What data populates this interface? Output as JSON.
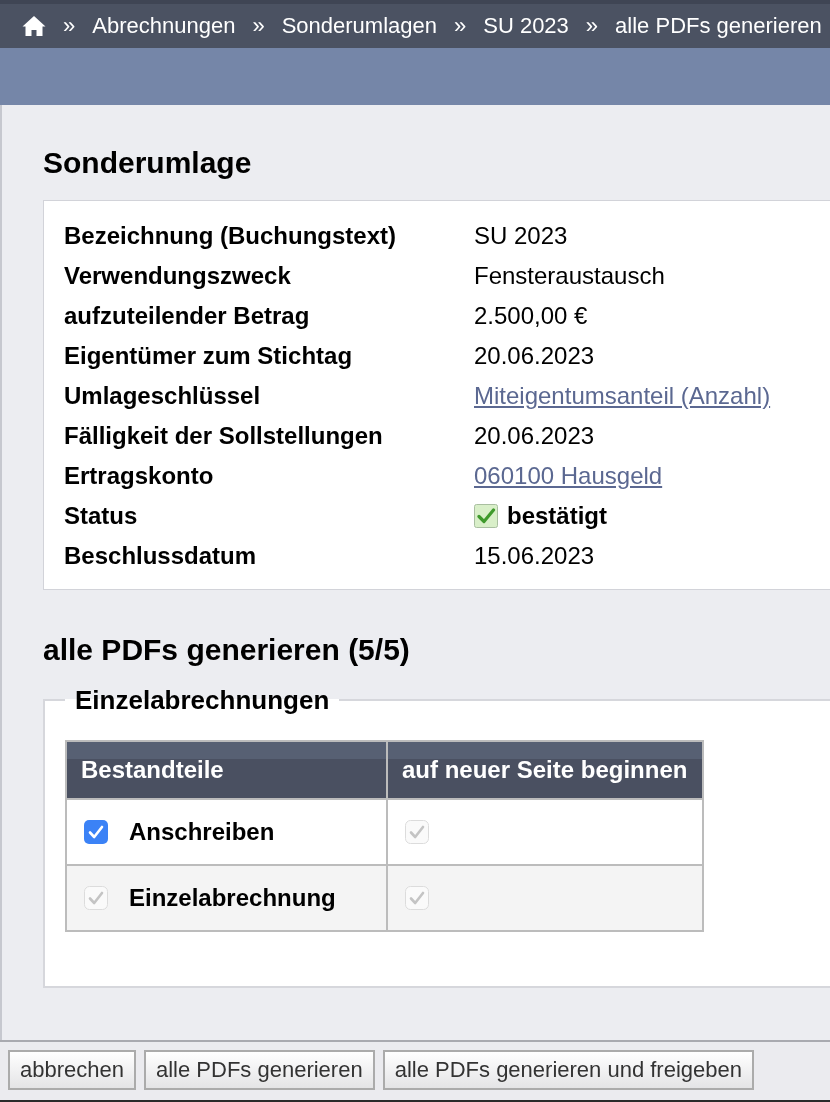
{
  "breadcrumb": {
    "items": [
      {
        "separator": "»",
        "label": "Abrechnungen"
      },
      {
        "separator": "»",
        "label": "Sonderumlagen"
      },
      {
        "separator": "»",
        "label": "SU 2023"
      },
      {
        "separator": "»",
        "label": "alle PDFs generieren"
      }
    ]
  },
  "details": {
    "title": "Sonderumlage",
    "rows": [
      {
        "label": "Bezeichnung (Buchungstext)",
        "value": "SU 2023",
        "kind": "text"
      },
      {
        "label": "Verwendungszweck",
        "value": "Fensteraustausch",
        "kind": "text"
      },
      {
        "label": "aufzuteilender Betrag",
        "value": "2.500,00 €",
        "kind": "text"
      },
      {
        "label": "Eigentümer zum Stichtag",
        "value": "20.06.2023",
        "kind": "text"
      },
      {
        "label": "Umlageschlüssel",
        "value": "Miteigentumsanteil (Anzahl)",
        "kind": "link"
      },
      {
        "label": "Fälligkeit der Sollstellungen",
        "value": "20.06.2023",
        "kind": "text"
      },
      {
        "label": "Ertragskonto",
        "value": "060100 Hausgeld",
        "kind": "link"
      },
      {
        "label": "Status",
        "value": "bestätigt",
        "kind": "status"
      },
      {
        "label": "Beschlussdatum",
        "value": "15.06.2023",
        "kind": "text"
      }
    ]
  },
  "generate": {
    "title": "alle PDFs generieren (5/5)",
    "fieldset": {
      "legend": "Einzelabrechnungen",
      "columns": [
        "Bestandteile",
        "auf neuer Seite beginnen"
      ],
      "rows": [
        {
          "label": "Anschreiben",
          "include": {
            "checked": true,
            "disabled": false
          },
          "new_page": {
            "checked": true,
            "disabled": true
          }
        },
        {
          "label": "Einzelabrechnung",
          "include": {
            "checked": true,
            "disabled": true
          },
          "new_page": {
            "checked": true,
            "disabled": true
          }
        }
      ]
    }
  },
  "buttons": [
    {
      "label": "abbrechen"
    },
    {
      "label": "alle PDFs generieren"
    },
    {
      "label": "alle PDFs generieren und freigeben"
    }
  ]
}
